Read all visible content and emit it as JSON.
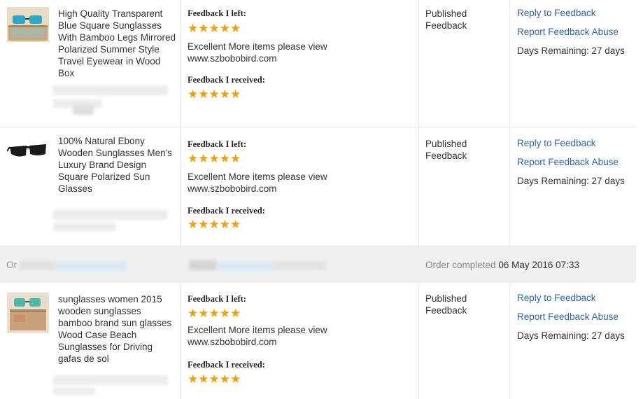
{
  "feedback_rows": [
    {
      "product_title": "High Quality Transparent Blue Square Sunglasses With Bamboo Legs Mirrored Polarized Summer Style Travel Eyewear in Wood Box",
      "thumbnail": "bamboo-sunglasses-box",
      "feedback_left_label": "Feedback I left:",
      "feedback_left_stars": "★★★★★",
      "feedback_left_text": "Excellent More items please view www.szbobobird.com",
      "feedback_received_label": "Feedback I received:",
      "feedback_received_stars": "★★★★★",
      "status": "Published Feedback",
      "reply_link": "Reply to Feedback",
      "report_link": "Report Feedback Abuse",
      "days_remaining": "Days Remaining: 27 days"
    },
    {
      "product_title": "100% Natural Ebony Wooden Sunglasses Men's Luxury Brand Design Square Polarized Sun Glasses",
      "thumbnail": "black-sunglasses",
      "feedback_left_label": "Feedback I left:",
      "feedback_left_stars": "★★★★★",
      "feedback_left_text": "Excellent More items please view www.szbobobird.com",
      "feedback_received_label": "Feedback I received:",
      "feedback_received_stars": "★★★★★",
      "status": "Published Feedback",
      "reply_link": "Reply to Feedback",
      "report_link": "Report Feedback Abuse",
      "days_remaining": "Days Remaining: 27 days"
    },
    {
      "product_title": "sunglasses women 2015 wooden sunglasses bamboo brand sun glasses Wood Case Beach Sunglasses for Driving gafas de sol",
      "thumbnail": "wood-case-sunglasses",
      "feedback_left_label": "Feedback I left:",
      "feedback_left_stars": "★★★★★",
      "feedback_left_text": "Excellent More items please view www.szbobobird.com",
      "feedback_received_label": "Feedback I received:",
      "feedback_received_stars": "★★★★★",
      "status": "Published Feedback",
      "reply_link": "Reply to Feedback",
      "report_link": "Report Feedback Abuse",
      "days_remaining": "Days Remaining: 27 days"
    }
  ],
  "order_bar": {
    "prefix": "Or",
    "completed_label": "Order completed",
    "completed_date": "06 May 2016 07:33"
  },
  "colors": {
    "link": "#2a64b0",
    "star": "#f5a000",
    "order_bar_bg": "#f0f0f0"
  }
}
